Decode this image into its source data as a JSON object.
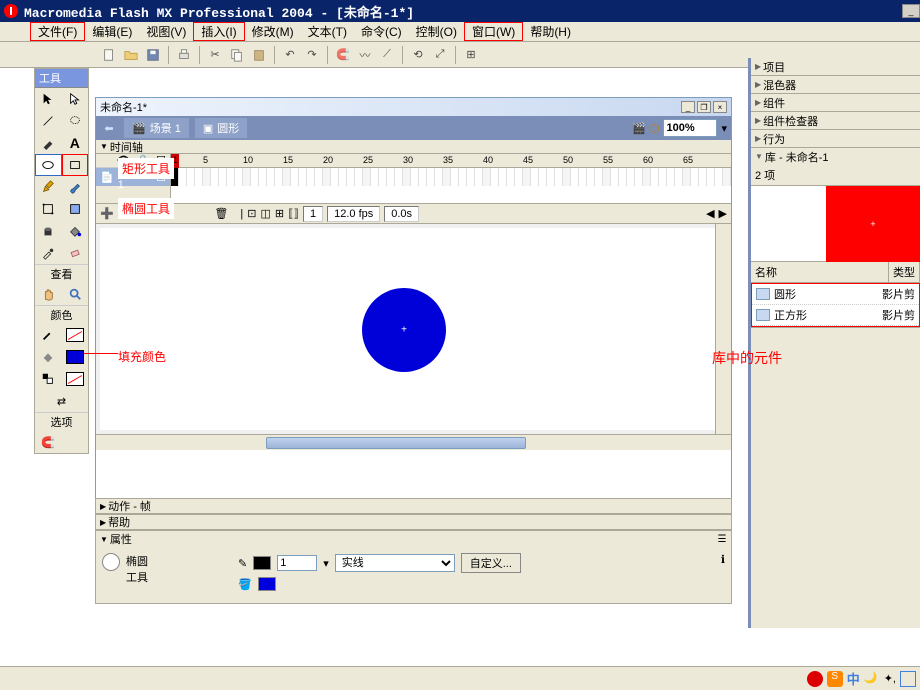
{
  "titlebar": {
    "title": "Macromedia Flash MX Professional 2004 - [未命名-1*]"
  },
  "menu": {
    "file": "文件(F)",
    "edit": "编辑(E)",
    "view": "视图(V)",
    "insert": "插入(I)",
    "modify": "修改(M)",
    "text": "文本(T)",
    "commands": "命令(C)",
    "control": "控制(O)",
    "window": "窗口(W)",
    "help": "帮助(H)"
  },
  "tools": {
    "header": "工具",
    "view_header": "查看",
    "color_header": "颜色",
    "options_header": "选项"
  },
  "doc": {
    "title": "未命名-1*",
    "scene": "场景 1",
    "symbol": "圆形",
    "zoom": "100%",
    "timeline_label": "时间轴",
    "layer": "图层 1",
    "frame": "1",
    "fps": "12.0 fps",
    "time": "0.0s",
    "ruler": [
      "1",
      "5",
      "10",
      "15",
      "20",
      "25",
      "30",
      "35",
      "40",
      "45",
      "50",
      "55",
      "60",
      "65"
    ]
  },
  "bottom": {
    "actions": "动作 - 帧",
    "help": "帮助",
    "props": "属性",
    "tool_name": "椭圆\n工具",
    "stroke_width": "1",
    "stroke_style": "实线",
    "custom": "自定义..."
  },
  "right": {
    "project": "项目",
    "mixer": "混色器",
    "components": "组件",
    "comp_inspector": "组件检查器",
    "behaviors": "行为",
    "library": "库 - 未命名-1",
    "lib_count": "2 项",
    "col_name": "名称",
    "col_type": "类型",
    "item1_name": "圆形",
    "item1_type": "影片剪",
    "item2_name": "正方形",
    "item2_type": "影片剪"
  },
  "annotations": {
    "rect_tool": "矩形工具",
    "oval_tool": "椭圆工具",
    "fill_color": "填充颜色",
    "lib_symbols": "库中的元件"
  }
}
